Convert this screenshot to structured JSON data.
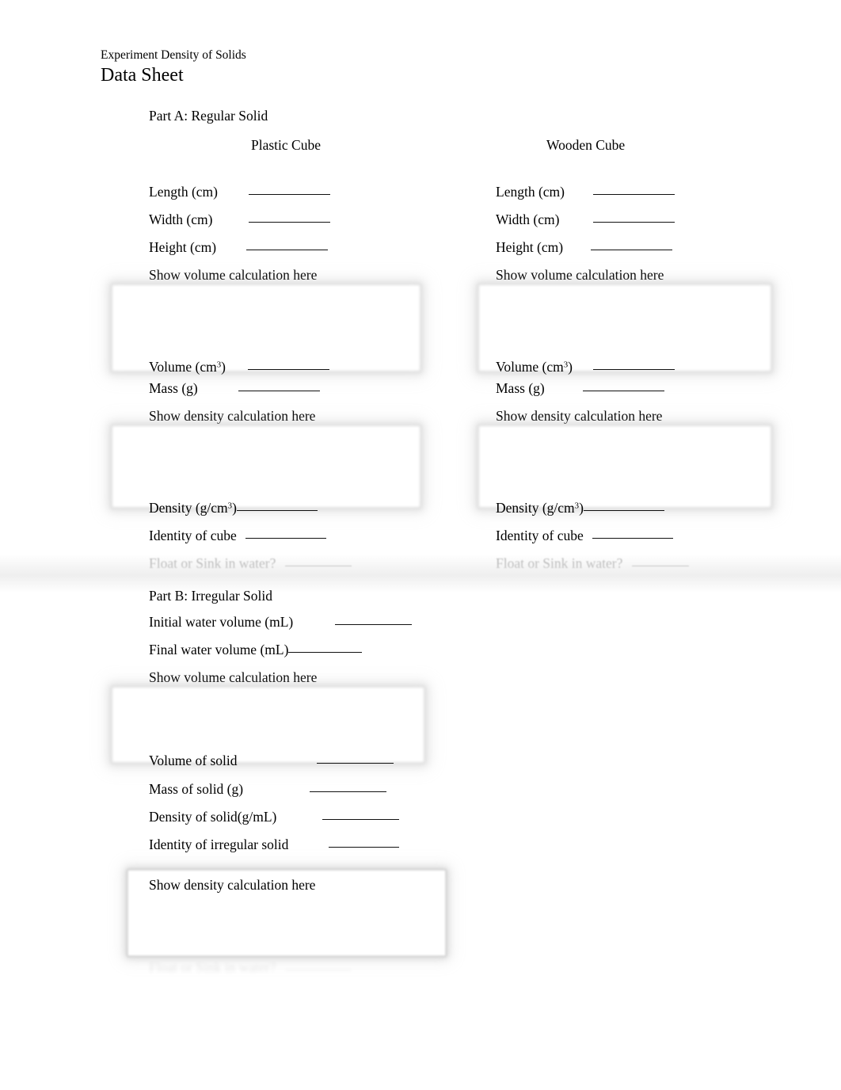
{
  "document": {
    "header_line": "Experiment Density of Solids",
    "title": "Data Sheet"
  },
  "part_a": {
    "section_label": "Part A: Regular Solid",
    "columns": [
      {
        "heading": "Plastic Cube",
        "fields": [
          {
            "label": "Length (cm)",
            "value": ""
          },
          {
            "label": "Width (cm)",
            "value": ""
          },
          {
            "label": "Height (cm)",
            "value": ""
          }
        ],
        "volume_box_label": "Show volume calculation here",
        "volume_field_label": "Volume (cm",
        "volume_field_sup": "3",
        "volume_field_close": ")",
        "mass_label": "Mass (g)",
        "density_box_label": "Show density calculation here",
        "density_field_label": "Density (g/cm",
        "density_field_sup": "3",
        "density_field_close": ")",
        "identity_label": "Identity of cube",
        "float_sink_label": "Float or Sink in water?"
      },
      {
        "heading": "Wooden Cube",
        "fields": [
          {
            "label": "Length (cm)",
            "value": ""
          },
          {
            "label": "Width (cm)",
            "value": ""
          },
          {
            "label": "Height (cm)",
            "value": ""
          }
        ],
        "volume_box_label": "Show volume calculation here",
        "volume_field_label": "Volume (cm",
        "volume_field_sup": "3",
        "volume_field_close": ")",
        "mass_label": "Mass (g)",
        "density_box_label": "Show density calculation here",
        "density_field_label": "Density (g/cm",
        "density_field_sup": "3",
        "density_field_close": ")",
        "identity_label": "Identity of cube",
        "float_sink_label": "Float or Sink in water?"
      }
    ]
  },
  "part_b": {
    "section_label": "Part B:  Irregular Solid",
    "initial_volume_label": "Initial water volume (mL)",
    "final_volume_label": "Final water volume (mL)",
    "volume_box_label": "Show volume calculation here",
    "volume_of_solid_label": "Volume of solid",
    "mass_of_solid_label": "Mass of solid (g)",
    "density_of_solid_label": "Density of solid(g/mL)",
    "identity_label": "Identity of irregular solid",
    "density_box_label": "Show density calculation here",
    "float_sink_label": "Float or Sink in water?"
  },
  "footer": {
    "left": "",
    "center": "",
    "page_number": ""
  }
}
